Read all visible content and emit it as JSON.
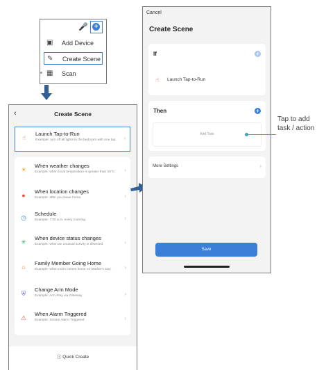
{
  "popup": {
    "items": [
      {
        "label": "Add Device",
        "icon": "add-device-icon"
      },
      {
        "label": "Create Scene",
        "icon": "create-scene-icon"
      },
      {
        "label": "Scan",
        "icon": "scan-icon"
      }
    ]
  },
  "left_screen": {
    "title": "Create Scene",
    "options": [
      {
        "title": "Launch Tap-to-Run",
        "desc": "Example: turn off all lights in the bedroom with one tap.",
        "icon": "tap-icon",
        "color": "#e8603c"
      },
      {
        "title": "When weather changes",
        "desc": "Example: when local temperature is greater than 28°C.",
        "icon": "sun-icon",
        "color": "#f4a623"
      },
      {
        "title": "When location changes",
        "desc": "Example: after you leave home.",
        "icon": "location-icon",
        "color": "#e8503c"
      },
      {
        "title": "Schedule",
        "desc": "Example: 7:00 a.m. every morning.",
        "icon": "clock-icon",
        "color": "#3b7fd9"
      },
      {
        "title": "When device status changes",
        "desc": "Example: when an unusual activity is detected.",
        "icon": "device-status-icon",
        "color": "#2fb36a"
      },
      {
        "title": "Family Member Going Home",
        "desc": "Example: when mom comes home on Mother's Day.",
        "icon": "home-icon",
        "color": "#f08a3c"
      },
      {
        "title": "Change Arm Mode",
        "desc": "Example: Arm Stay via Gateway",
        "icon": "shield-icon",
        "color": "#5b5bd6"
      },
      {
        "title": "When Alarm Triggered",
        "desc": "Example: Smoke Alarm Triggered",
        "icon": "alarm-icon",
        "color": "#e8503c"
      }
    ],
    "quick_create": "Quick Create"
  },
  "right_screen": {
    "cancel": "Cancel",
    "title": "Create Scene",
    "if_label": "If",
    "if_task": "Launch Tap-to-Run",
    "then_label": "Then",
    "add_task": "Add Task",
    "more_settings": "More Settings",
    "save": "Save"
  },
  "callout": "Tap to add task / action",
  "colors": {
    "accent": "#3b7fd9",
    "callout": "#3b9fd0"
  }
}
